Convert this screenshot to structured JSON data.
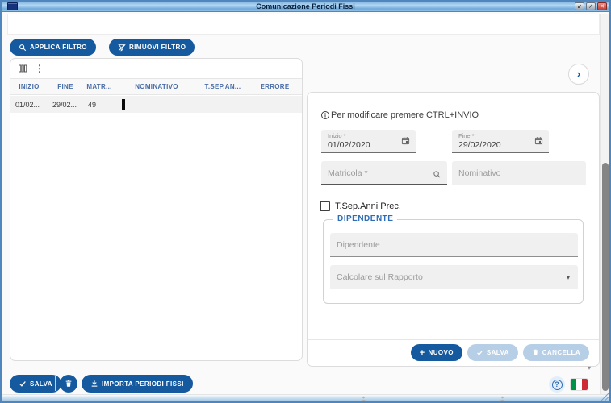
{
  "window": {
    "title": "Comunicazione Periodi Fissi"
  },
  "glyphs": {
    "restore": "↙",
    "maximize": "↗",
    "close": "✕",
    "kebab": "⋮",
    "chevron_right": "›",
    "caret_down": "▾",
    "plus": "+",
    "help": "?"
  },
  "toolbar": {
    "applica_filtro": "APPLICA FILTRO",
    "rimuovi_filtro": "RIMUOVI FILTRO"
  },
  "grid": {
    "columns": [
      "INIZIO",
      "FINE",
      "MATR...",
      "NOMINATIVO",
      "T.SEP.AN...",
      "ERRORE"
    ],
    "rows": [
      [
        "01/02...",
        "29/02...",
        "49",
        "",
        "",
        ""
      ]
    ]
  },
  "form": {
    "info_text": "Per modificare premere CTRL+INVIO",
    "inizio_label": "Inizio *",
    "inizio_value": "01/02/2020",
    "fine_label": "Fine *",
    "fine_value": "29/02/2020",
    "matricola_placeholder": "Matricola *",
    "nominativo_placeholder": "Nominativo",
    "checkbox_label": "T.Sep.Anni Prec.",
    "dipendente_legend": "DIPENDENTE",
    "dipendente_placeholder": "Dipendente",
    "rapporto_placeholder": "Calcolare sul Rapporto",
    "nuovo_label": "NUOVO",
    "salva_label": "SALVA",
    "cancella_label": "CANCELLA"
  },
  "footer": {
    "salva_label": "SALVA",
    "importa_label": "IMPORTA PERIODI FISSI"
  },
  "colors": {
    "primary": "#15599f",
    "disabled_button": "#b7cfe6",
    "grid_header_text": "#4a6da7",
    "flag_green": "#009246",
    "flag_white": "#ffffff",
    "flag_red": "#ce2b37"
  }
}
